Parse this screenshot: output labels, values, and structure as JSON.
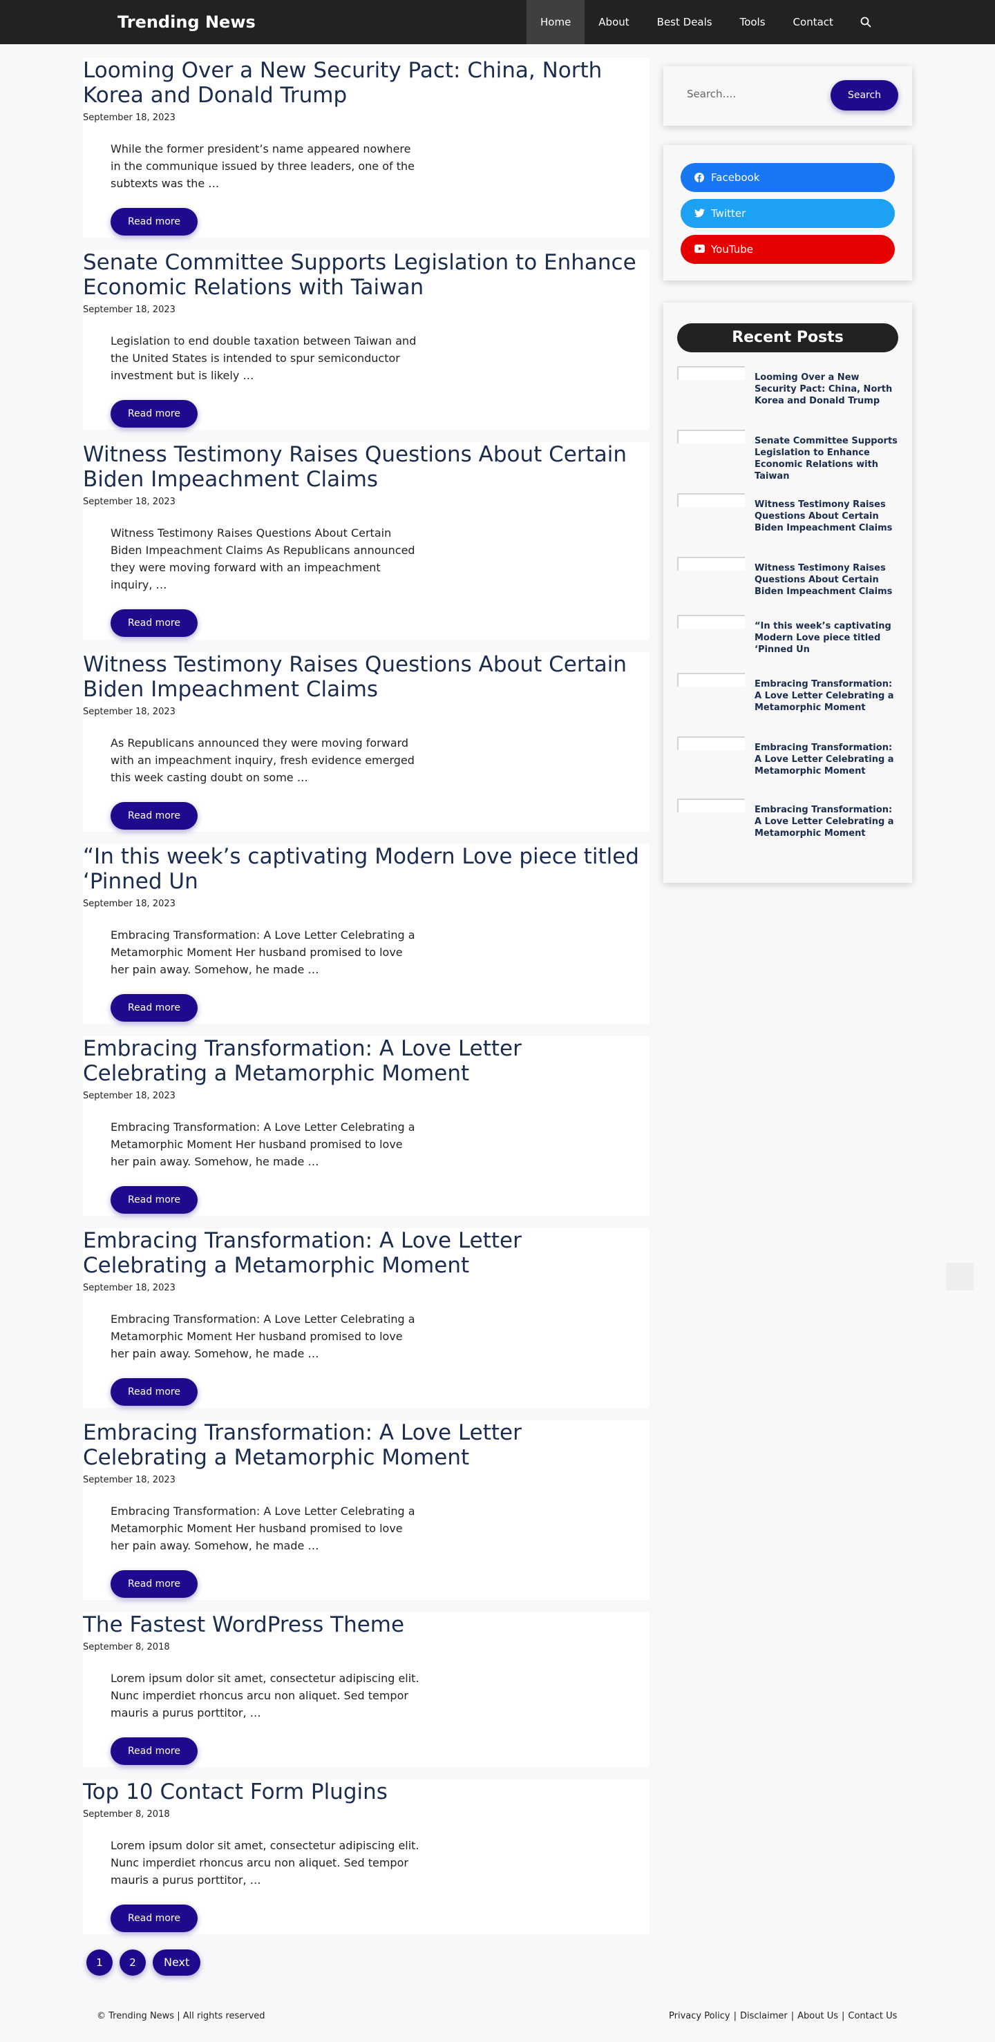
{
  "header": {
    "site_title": "Trending News",
    "nav": [
      "Home",
      "About",
      "Best Deals",
      "Tools",
      "Contact"
    ]
  },
  "posts": [
    {
      "title": "Looming Over a New Security Pact: China, North Korea and Donald Trump",
      "date": "September 18, 2023",
      "excerpt": "While the former president’s name appeared nowhere in the communique issued by three leaders, one of the subtexts was the …",
      "read_more": "Read more"
    },
    {
      "title": "Senate Committee Supports Legislation to Enhance Economic Relations with Taiwan",
      "date": "September 18, 2023",
      "excerpt": "Legislation to end double taxation between Taiwan and the United States is intended to spur semiconductor investment but is likely …",
      "read_more": "Read more"
    },
    {
      "title": "Witness Testimony Raises Questions About Certain Biden Impeachment Claims",
      "date": "September 18, 2023",
      "excerpt": "Witness Testimony Raises Questions About Certain Biden Impeachment Claims As Republicans announced they were moving forward with an impeachment inquiry, …",
      "read_more": "Read more"
    },
    {
      "title": "Witness Testimony Raises Questions About Certain Biden Impeachment Claims",
      "date": "September 18, 2023",
      "excerpt": "As Republicans announced they were moving forward with an impeachment inquiry, fresh evidence emerged this week casting doubt on some …",
      "read_more": "Read more"
    },
    {
      "title": "“In this week’s captivating Modern Love piece titled ‘Pinned Un",
      "date": "September 18, 2023",
      "excerpt": "Embracing Transformation: A Love Letter Celebrating a Metamorphic Moment Her husband promised to love her pain away. Somehow, he made …",
      "read_more": "Read more"
    },
    {
      "title": "Embracing Transformation: A Love Letter Celebrating a Metamorphic Moment",
      "date": "September 18, 2023",
      "excerpt": "Embracing Transformation: A Love Letter Celebrating a Metamorphic Moment Her husband promised to love her pain away. Somehow, he made …",
      "read_more": "Read more"
    },
    {
      "title": "Embracing Transformation: A Love Letter Celebrating a Metamorphic Moment",
      "date": "September 18, 2023",
      "excerpt": "Embracing Transformation: A Love Letter Celebrating a Metamorphic Moment Her husband promised to love her pain away. Somehow, he made …",
      "read_more": "Read more"
    },
    {
      "title": "Embracing Transformation: A Love Letter Celebrating a Metamorphic Moment",
      "date": "September 18, 2023",
      "excerpt": "Embracing Transformation: A Love Letter Celebrating a Metamorphic Moment Her husband promised to love her pain away. Somehow, he made …",
      "read_more": "Read more"
    },
    {
      "title": "The Fastest WordPress Theme",
      "date": "September 8, 2018",
      "excerpt": "Lorem ipsum dolor sit amet, consectetur adipiscing elit. Nunc imperdiet rhoncus arcu non aliquet. Sed tempor mauris a purus porttitor, …",
      "read_more": "Read more"
    },
    {
      "title": "Top 10 Contact Form Plugins",
      "date": "September 8, 2018",
      "excerpt": "Lorem ipsum dolor sit amet, consectetur adipiscing elit. Nunc imperdiet rhoncus arcu non aliquet. Sed tempor mauris a purus porttitor, …",
      "read_more": "Read more"
    }
  ],
  "pagination": {
    "pages": [
      "1",
      "2"
    ],
    "next": "Next"
  },
  "sidebar": {
    "search": {
      "placeholder": "Search….",
      "button": "Search"
    },
    "social": [
      {
        "label": "Facebook",
        "color": "#1877f2",
        "icon": "facebook-icon"
      },
      {
        "label": "Twitter",
        "color": "#1da1f2",
        "icon": "twitter-icon"
      },
      {
        "label": "YouTube",
        "color": "#e60000",
        "icon": "youtube-icon"
      }
    ],
    "recent_title": "Recent Posts",
    "recent": [
      "Looming Over a New Security Pact: China, North Korea and Donald Trump",
      "Senate Committee Supports Legislation to Enhance Economic Relations with Taiwan",
      "Witness Testimony Raises Questions About Certain Biden Impeachment Claims",
      "Witness Testimony Raises Questions About Certain Biden Impeachment Claims",
      "“In this week’s captivating Modern Love piece titled ‘Pinned Un",
      "Embracing Transformation: A Love Letter Celebrating a Metamorphic Moment",
      "Embracing Transformation: A Love Letter Celebrating a Metamorphic Moment",
      "Embracing Transformation: A Love Letter Celebrating a Metamorphic Moment"
    ]
  },
  "footer": {
    "copyright": "© Trending News | All rights reserved",
    "links": [
      "Privacy Policy",
      "Disclaimer",
      "About Us",
      "Contact Us"
    ]
  },
  "colors": {
    "header_bg": "#222222",
    "accent": "#1e0a8c",
    "title": "#1b2c4f"
  }
}
